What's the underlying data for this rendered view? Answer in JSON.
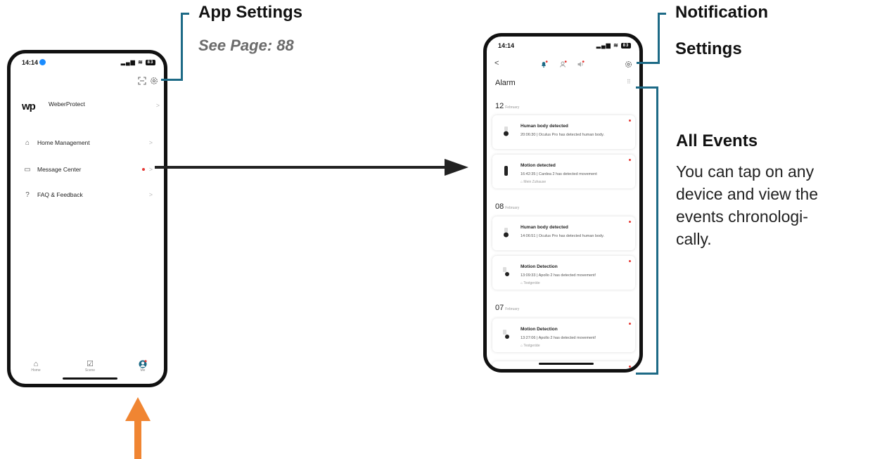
{
  "annotations": {
    "app_settings_title": "App Settings",
    "app_settings_ref": "See Page: 88",
    "notification_settings_line1": "Notification",
    "notification_settings_line2": "Settings",
    "all_events_title": "All Events",
    "all_events_body": [
      "You can tap on any",
      "device and view the",
      "events chronologi-",
      "cally."
    ]
  },
  "colors": {
    "bracket": "#1d6a86",
    "up_arrow": "#f08532",
    "arrow": "#222222",
    "badge_red": "#e53935",
    "accent_blue": "#1a8cff"
  },
  "left_phone": {
    "status_time": "14:14",
    "battery": "83",
    "brand_logo": "wp",
    "brand_name": "WeberProtect",
    "menu": [
      {
        "icon": "home-outline-icon",
        "label": "Home Management"
      },
      {
        "icon": "message-icon",
        "label": "Message Center",
        "badge": true
      },
      {
        "icon": "question-circle-icon",
        "label": "FAQ & Feedback"
      }
    ],
    "tabs": [
      {
        "icon": "home-icon",
        "label": "Home"
      },
      {
        "icon": "scene-check-icon",
        "label": "Scene"
      },
      {
        "icon": "me-profile-icon",
        "label": "Me",
        "active": true
      }
    ]
  },
  "right_phone": {
    "status_time": "14:14",
    "battery": "83",
    "page_title": "Alarm",
    "groups": [
      {
        "day": "12",
        "month": "February",
        "events": [
          {
            "title": "Human body detected",
            "desc": "20:06:30 | Oculus Pro has detected human body.",
            "location": ""
          },
          {
            "title": "Motion detected",
            "desc": "16:42:35 | Cardea 2 has detected movement",
            "location": "Mein Zuhause"
          }
        ]
      },
      {
        "day": "08",
        "month": "February",
        "events": [
          {
            "title": "Human body detected",
            "desc": "14:06:51 | Oculus Pro has detected human body.",
            "location": ""
          },
          {
            "title": "Motion Detection",
            "desc": "13:09:33 | Apollo 2 has detected movement!",
            "location": "Testgeräte"
          }
        ]
      },
      {
        "day": "07",
        "month": "February",
        "events": [
          {
            "title": "Motion Detection",
            "desc": "13:27:06 | Apollo 2 has detected movement!",
            "location": "Testgeräte"
          }
        ]
      }
    ]
  }
}
